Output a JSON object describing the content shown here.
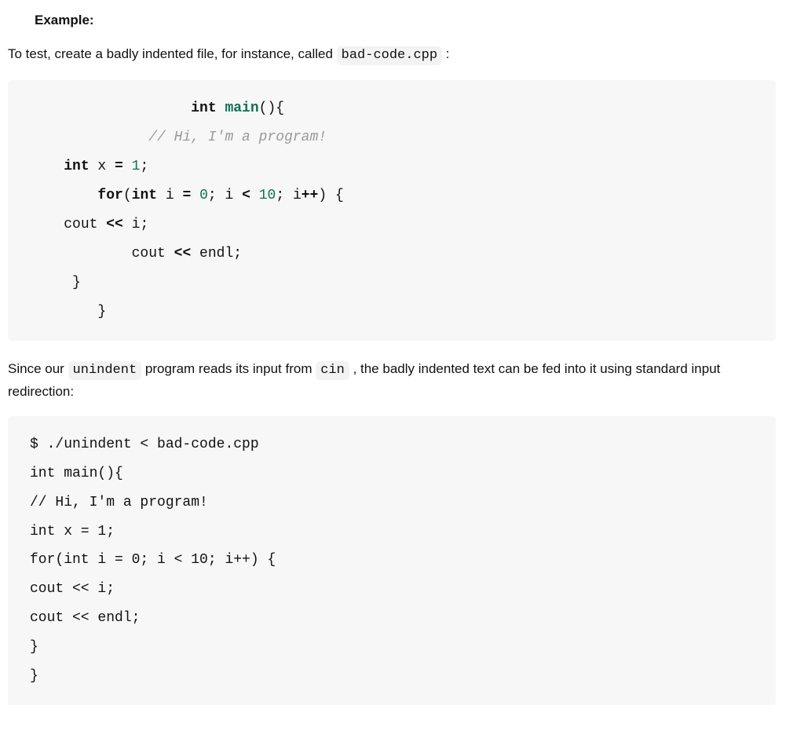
{
  "heading": "Example:",
  "para1_parts": {
    "before": "To test, create a badly indented file, for instance, called ",
    "code": "bad-code.cpp",
    "after": " :"
  },
  "code1": {
    "lines": [
      {
        "indent": "                   ",
        "tokens": [
          {
            "t": "int ",
            "c": "kw"
          },
          {
            "t": "main",
            "c": "fn"
          },
          {
            "t": "(){",
            "c": "plain"
          }
        ]
      },
      {
        "indent": "              ",
        "tokens": [
          {
            "t": "// Hi, I'm a program!",
            "c": "cmt"
          }
        ]
      },
      {
        "indent": "    ",
        "tokens": [
          {
            "t": "int",
            "c": "kw"
          },
          {
            "t": " x ",
            "c": "plain"
          },
          {
            "t": "=",
            "c": "op"
          },
          {
            "t": " ",
            "c": "plain"
          },
          {
            "t": "1",
            "c": "num"
          },
          {
            "t": ";",
            "c": "plain"
          }
        ]
      },
      {
        "indent": "        ",
        "tokens": [
          {
            "t": "for",
            "c": "kw"
          },
          {
            "t": "(",
            "c": "plain"
          },
          {
            "t": "int",
            "c": "kw"
          },
          {
            "t": " i ",
            "c": "plain"
          },
          {
            "t": "=",
            "c": "op"
          },
          {
            "t": " ",
            "c": "plain"
          },
          {
            "t": "0",
            "c": "num"
          },
          {
            "t": "; i ",
            "c": "plain"
          },
          {
            "t": "<",
            "c": "op"
          },
          {
            "t": " ",
            "c": "plain"
          },
          {
            "t": "10",
            "c": "num"
          },
          {
            "t": "; i",
            "c": "plain"
          },
          {
            "t": "++",
            "c": "op"
          },
          {
            "t": ") {",
            "c": "plain"
          }
        ]
      },
      {
        "indent": "    ",
        "tokens": [
          {
            "t": "cout ",
            "c": "plain"
          },
          {
            "t": "<<",
            "c": "op"
          },
          {
            "t": " i;",
            "c": "plain"
          }
        ]
      },
      {
        "indent": "            ",
        "tokens": [
          {
            "t": "cout ",
            "c": "plain"
          },
          {
            "t": "<<",
            "c": "op"
          },
          {
            "t": " endl;",
            "c": "plain"
          }
        ]
      },
      {
        "indent": "     ",
        "tokens": [
          {
            "t": "}",
            "c": "plain"
          }
        ]
      },
      {
        "indent": "        ",
        "tokens": [
          {
            "t": "}",
            "c": "plain"
          }
        ]
      }
    ]
  },
  "para2_parts": {
    "p1": "Since our ",
    "c1": "unindent",
    "p2": " program reads its input from ",
    "c2": "cin",
    "p3": " , the badly indented text can be fed into it using standard input redirection:"
  },
  "code2": {
    "lines": [
      "$ ./unindent < bad-code.cpp",
      "int main(){",
      "// Hi, I'm a program!",
      "int x = 1;",
      "for(int i = 0; i < 10; i++) {",
      "cout << i;",
      "cout << endl;",
      "}",
      "}"
    ]
  }
}
